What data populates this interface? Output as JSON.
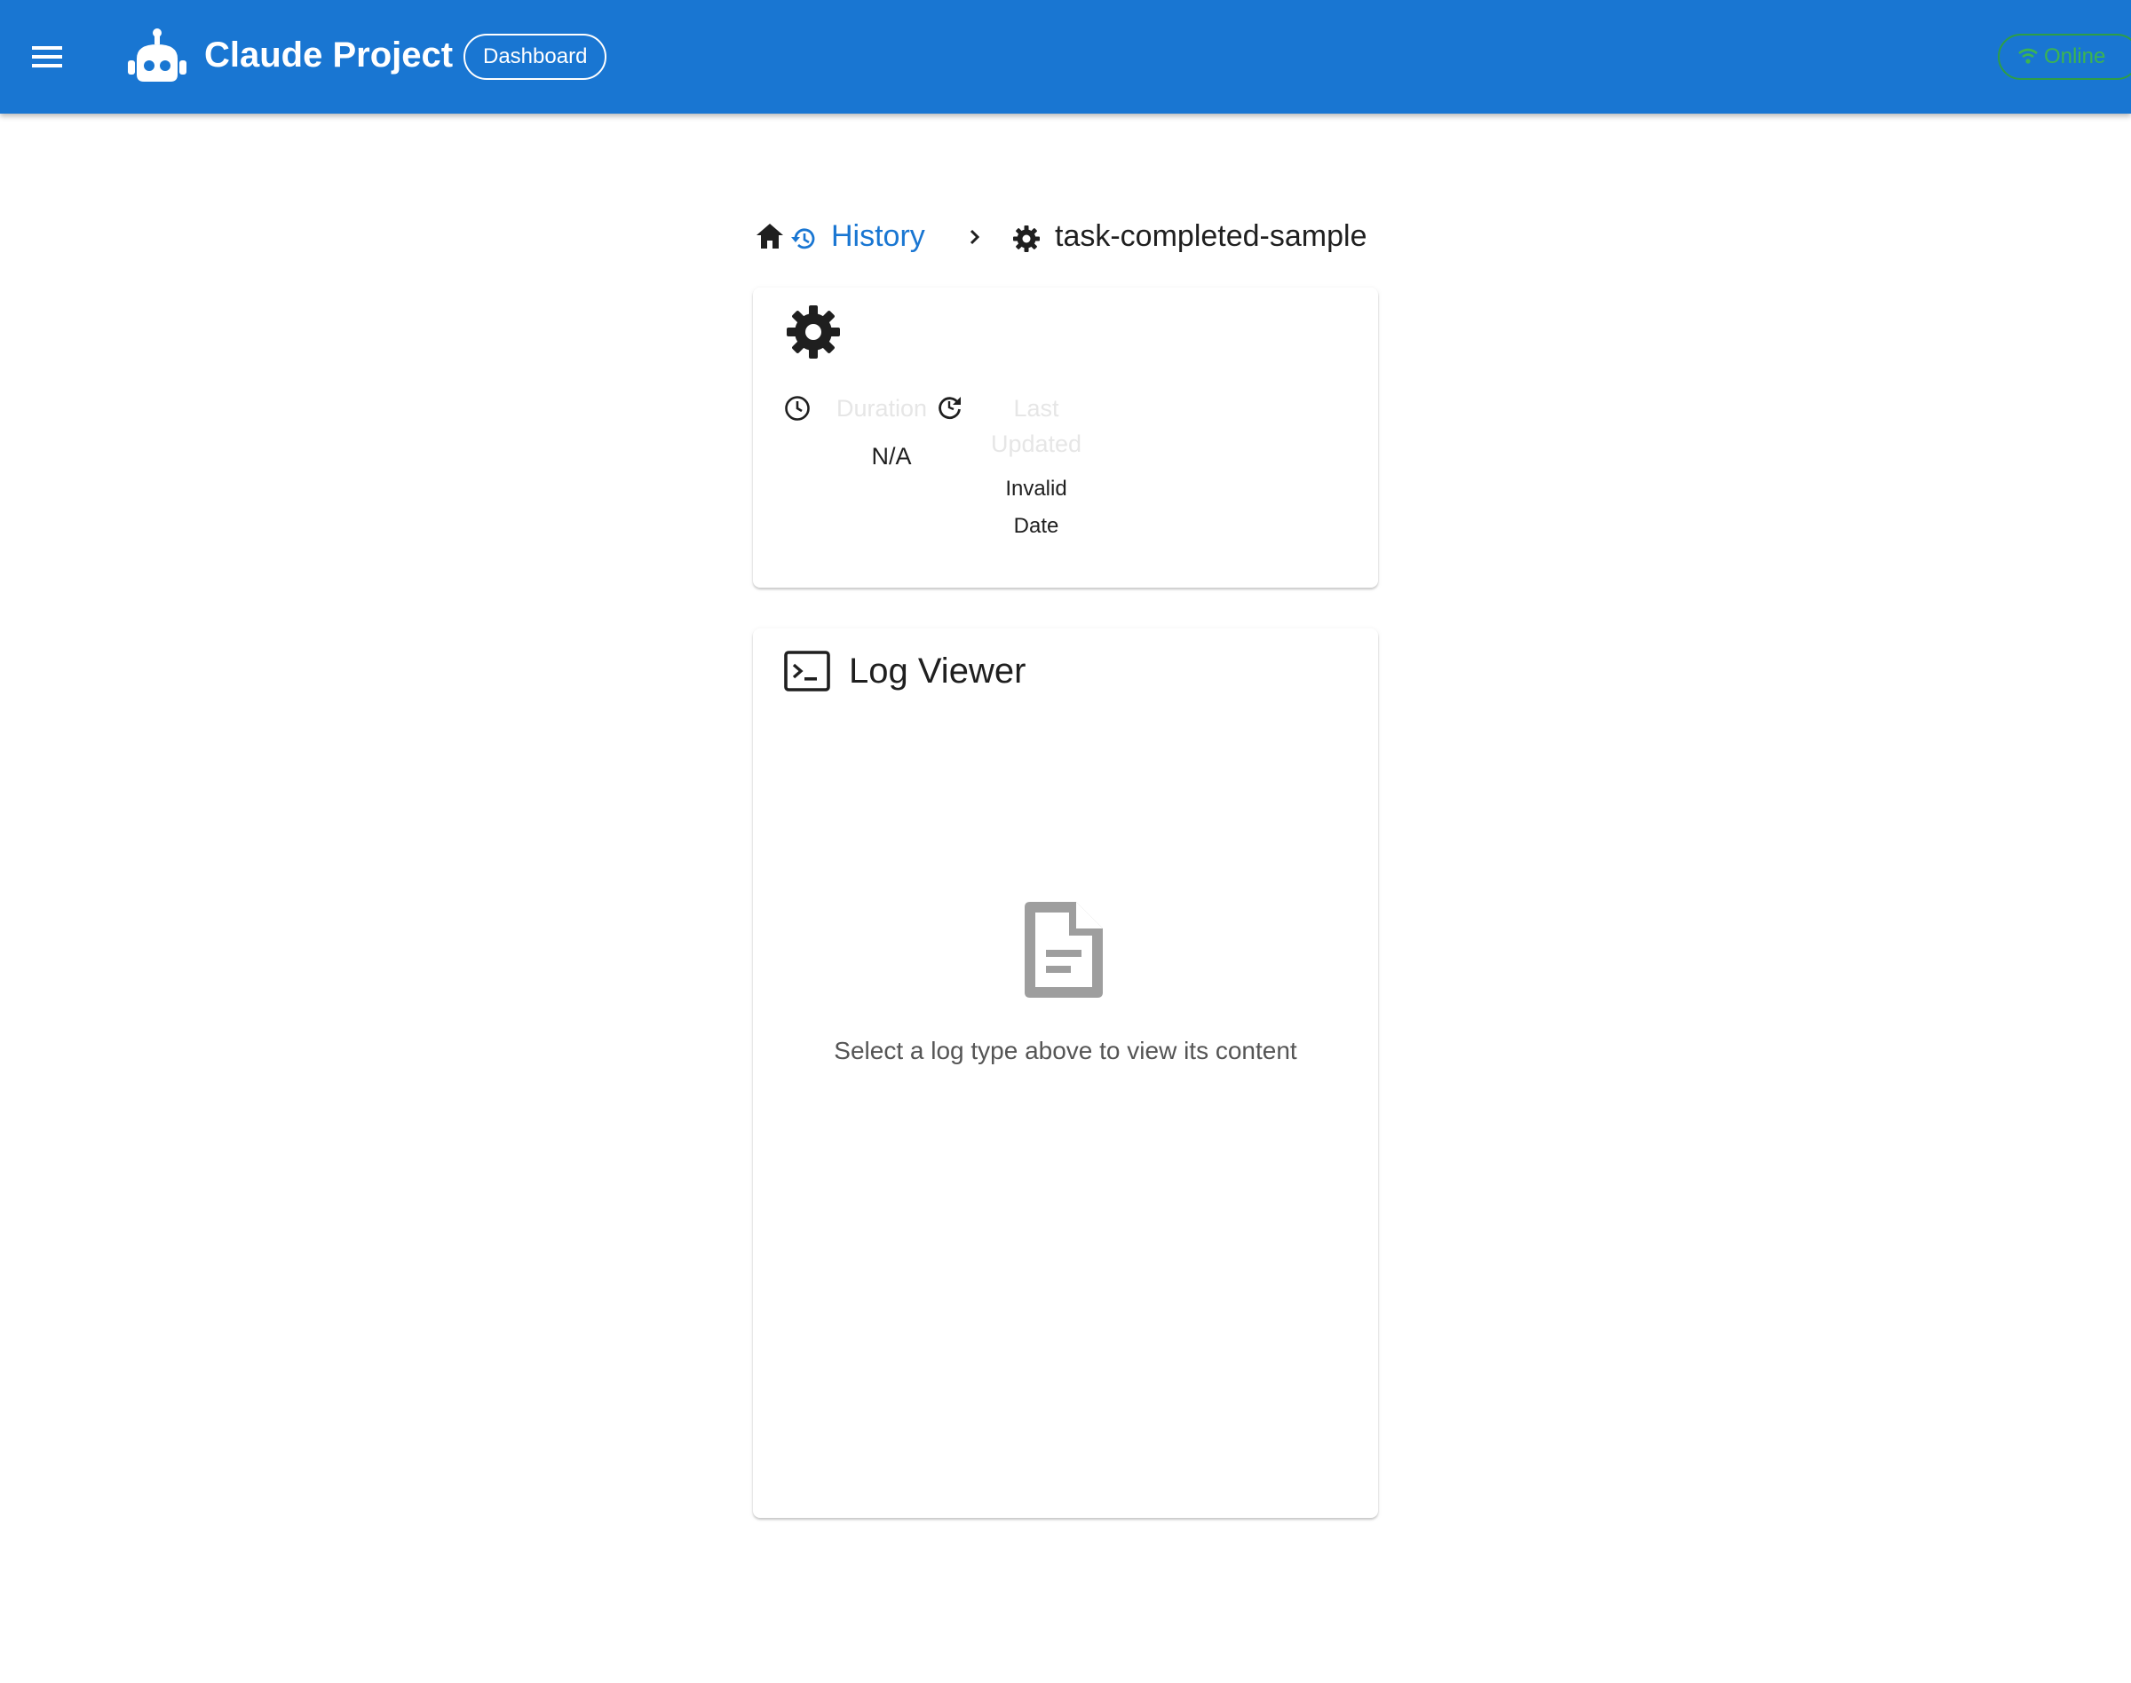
{
  "colors": {
    "appbar": "#1976d2",
    "online": "#3cb54f",
    "link": "#1976d2",
    "muted_label": "#e6e6e6"
  },
  "appbar": {
    "menu_icon": "hamburger-menu-icon",
    "logo_icon": "robot-icon",
    "title": "Claude Project",
    "dashboard_chip": "Dashboard",
    "status_icon": "wifi-icon",
    "status": "Online"
  },
  "breadcrumb": {
    "home_icon": "home-icon",
    "history_icon": "history-icon",
    "history_label": "History",
    "separator_icon": "chevron-right-icon",
    "current_icon": "gear-icon",
    "current_label": "task-completed-sample"
  },
  "task_info": {
    "header_icon": "gear-icon",
    "duration": {
      "icon": "clock-icon",
      "label": "Duration",
      "value": "N/A"
    },
    "last_updated": {
      "icon": "refresh-icon",
      "label_line1": "Last",
      "label_line2": "Updated",
      "value_line1": "Invalid",
      "value_line2": "Date"
    }
  },
  "log_viewer": {
    "icon": "terminal-icon",
    "title": "Log Viewer",
    "empty_icon": "document-icon",
    "empty_message": "Select a log type above to view its content"
  }
}
